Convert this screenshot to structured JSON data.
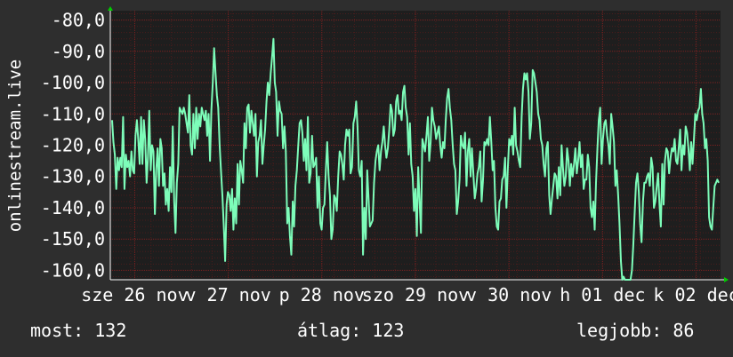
{
  "chart_data": {
    "type": "line",
    "ylabel": "onlinestream.live",
    "yticks": [
      "-80,0",
      "-90,0",
      "-100,0",
      "-110,0",
      "-120,0",
      "-130,0",
      "-140,0",
      "-150,0",
      "-160,0"
    ],
    "ytick_values": [
      -80,
      -90,
      -100,
      -110,
      -120,
      -130,
      -140,
      -150,
      -160
    ],
    "ylim": [
      -163,
      -77
    ],
    "xlim": [
      0,
      150
    ],
    "xticks": [
      {
        "label": "sze 26 nov",
        "x": 6
      },
      {
        "label": "v 27 nov",
        "x": 29
      },
      {
        "label": "p 28 nov",
        "x": 52
      },
      {
        "label": "szo 29 nov",
        "x": 75
      },
      {
        "label": "v 30 nov",
        "x": 98
      },
      {
        "label": "h 01 dec",
        "x": 121
      },
      {
        "label": "k 02 dec",
        "x": 144
      }
    ],
    "grid": true,
    "series": [
      {
        "color": "#7dfcb9",
        "values": [
          -112,
          -119,
          -123,
          -134,
          -124,
          -128,
          -124,
          -127,
          -111,
          -134,
          -123,
          -127,
          -125,
          -130,
          -122,
          -128,
          -129,
          -117,
          -112,
          -118,
          -126,
          -111,
          -126,
          -112,
          -118,
          -132,
          -124,
          -109,
          -128,
          -120,
          -122,
          -142,
          -128,
          -121,
          -133,
          -118,
          -121,
          -133,
          -129,
          -139,
          -134,
          -141,
          -127,
          -135,
          -114,
          -138,
          -148,
          -132,
          -126,
          -108,
          -109,
          -110,
          -108,
          -110,
          -113,
          -116,
          -104,
          -120,
          -123,
          -110,
          -121,
          -108,
          -118,
          -110,
          -114,
          -108,
          -110,
          -112,
          -109,
          -117,
          -110,
          -125,
          -109,
          -100,
          -89,
          -97,
          -104,
          -108,
          -120,
          -128,
          -136,
          -146,
          -157,
          -139,
          -135,
          -136,
          -141,
          -134,
          -147,
          -137,
          -145,
          -126,
          -139,
          -125,
          -128,
          -132,
          -113,
          -121,
          -108,
          -107,
          -116,
          -109,
          -113,
          -117,
          -110,
          -130,
          -119,
          -117,
          -112,
          -126,
          -120,
          -115,
          -106,
          -100,
          -104,
          -97,
          -92,
          -86,
          -100,
          -103,
          -117,
          -106,
          -109,
          -110,
          -121,
          -114,
          -122,
          -145,
          -140,
          -149,
          -155,
          -138,
          -146,
          -133,
          -128,
          -120,
          -113,
          -112,
          -116,
          -125,
          -118,
          -128,
          -111,
          -132,
          -129,
          -117,
          -127,
          -126,
          -124,
          -140,
          -130,
          -145,
          -147,
          -140,
          -139,
          -128,
          -119,
          -130,
          -136,
          -150,
          -147,
          -136,
          -137,
          -141,
          -130,
          -122,
          -123,
          -126,
          -131,
          -120,
          -115,
          -117,
          -115,
          -129,
          -127,
          -113,
          -111,
          -106,
          -114,
          -128,
          -130,
          -125,
          -155,
          -140,
          -150,
          -128,
          -137,
          -146,
          -145,
          -144,
          -132,
          -125,
          -122,
          -120,
          -128,
          -122,
          -119,
          -114,
          -120,
          -124,
          -121,
          -115,
          -107,
          -109,
          -117,
          -115,
          -106,
          -104,
          -110,
          -109,
          -112,
          -103,
          -101,
          -108,
          -111,
          -123,
          -113,
          -126,
          -130,
          -141,
          -134,
          -149,
          -127,
          -138,
          -148,
          -118,
          -120,
          -122,
          -117,
          -111,
          -125,
          -119,
          -108,
          -112,
          -114,
          -118,
          -116,
          -114,
          -120,
          -124,
          -119,
          -121,
          -112,
          -105,
          -102,
          -108,
          -112,
          -120,
          -126,
          -128,
          -142,
          -138,
          -131,
          -117,
          -120,
          -121,
          -116,
          -133,
          -122,
          -118,
          -130,
          -121,
          -129,
          -137,
          -134,
          -129,
          -127,
          -122,
          -138,
          -131,
          -119,
          -120,
          -118,
          -120,
          -111,
          -119,
          -128,
          -125,
          -140,
          -146,
          -147,
          -138,
          -137,
          -131,
          -130,
          -124,
          -140,
          -128,
          -118,
          -120,
          -117,
          -123,
          -108,
          -120,
          -122,
          -125,
          -127,
          -111,
          -102,
          -97,
          -99,
          -97,
          -103,
          -118,
          -113,
          -96,
          -97,
          -100,
          -103,
          -110,
          -112,
          -118,
          -120,
          -126,
          -130,
          -121,
          -119,
          -136,
          -142,
          -137,
          -133,
          -129,
          -130,
          -137,
          -127,
          -136,
          -120,
          -127,
          -133,
          -130,
          -121,
          -125,
          -133,
          -126,
          -130,
          -126,
          -121,
          -129,
          -125,
          -119,
          -127,
          -123,
          -134,
          -131,
          -131,
          -123,
          -127,
          -140,
          -143,
          -138,
          -147,
          -132,
          -121,
          -112,
          -108,
          -126,
          -118,
          -113,
          -112,
          -117,
          -120,
          -126,
          -110,
          -114,
          -119,
          -133,
          -128,
          -136,
          -145,
          -157,
          -170,
          -162,
          -165,
          -170,
          -170,
          -170,
          -170,
          -160,
          -152,
          -142,
          -132,
          -129,
          -135,
          -145,
          -151,
          -138,
          -132,
          -132,
          -130,
          -129,
          -133,
          -124,
          -127,
          -140,
          -138,
          -133,
          -129,
          -139,
          -146,
          -126,
          -139,
          -125,
          -121,
          -122,
          -129,
          -124,
          -121,
          -122,
          -118,
          -125,
          -126,
          -121,
          -115,
          -128,
          -120,
          -123,
          -114,
          -116,
          -121,
          -128,
          -119,
          -126,
          -118,
          -110,
          -112,
          -109,
          -108,
          -102,
          -110,
          -113,
          -121,
          -118,
          -125,
          -143,
          -146,
          -147,
          -140,
          -133,
          -132,
          -131,
          -132
        ]
      }
    ]
  },
  "stats": {
    "now": "most: 132",
    "avg": "átlag: 123",
    "best": "legjobb: 86"
  },
  "colors": {
    "background": "#2e2e2e",
    "plot_background": "#1e1e1e",
    "grid": "#7a2020",
    "series": "#7dfcb9",
    "axis_arrow": "#00cc00"
  }
}
